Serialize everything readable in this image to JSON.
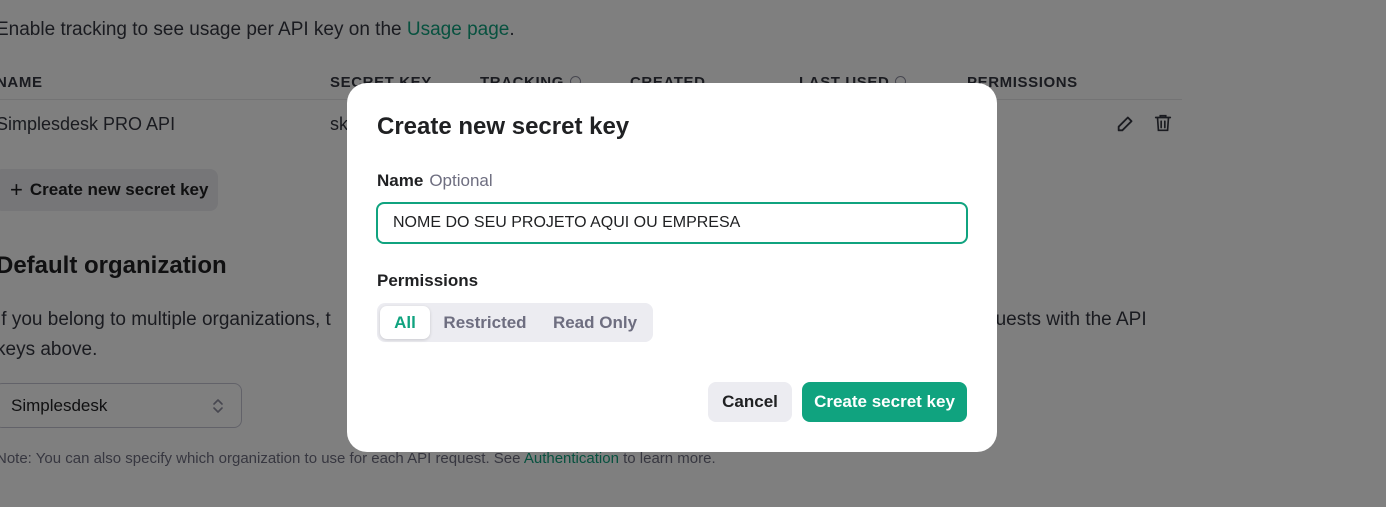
{
  "intro": {
    "text": "Enable tracking to see usage per API key on the ",
    "link": "Usage page",
    "end": "."
  },
  "table": {
    "headers": [
      "NAME",
      "SECRET KEY",
      "TRACKING",
      "CREATED",
      "LAST USED",
      "PERMISSIONS"
    ],
    "row": {
      "name": "Simplesdesk PRO API",
      "secret_key": "sk"
    }
  },
  "create_button": {
    "plus": "+",
    "label": "Create new secret key"
  },
  "default_org": {
    "title": "Default organization",
    "para_line1_left": "If you belong to multiple organizations, t",
    "para_line1_right": "quests with the API",
    "para_line2": "keys above.",
    "selected": "Simplesdesk",
    "note_prefix": "Note: You can also specify which organization to use for each API request. See ",
    "note_link": "Authentication",
    "note_suffix": " to learn more."
  },
  "modal": {
    "title": "Create new secret key",
    "name_label": "Name",
    "name_optional": "Optional",
    "name_value": "NOME DO SEU PROJETO AQUI OU EMPRESA",
    "permissions_label": "Permissions",
    "permission_options": [
      "All",
      "Restricted",
      "Read Only"
    ],
    "selected_permission": "All",
    "cancel": "Cancel",
    "submit": "Create secret key"
  },
  "colors": {
    "accent": "#10a37f",
    "overlay": "rgba(0,0,0,0.5)"
  },
  "icons": [
    "info-icon",
    "edit-icon",
    "trash-icon",
    "plus-icon",
    "chevron-up-down-icon"
  ]
}
